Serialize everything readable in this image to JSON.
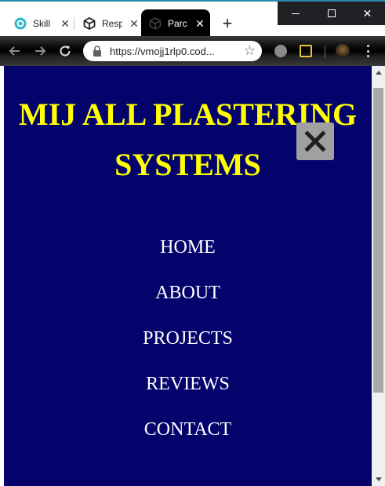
{
  "browser": {
    "tabs": [
      {
        "title": "Skill",
        "icon": "skillshare-icon",
        "active": false
      },
      {
        "title": "Resp",
        "icon": "codesandbox-icon",
        "active": false
      },
      {
        "title": "Parc",
        "icon": "codesandbox-icon",
        "active": true
      }
    ],
    "close_tab_glyph": "✕",
    "new_tab_glyph": "+",
    "window_close_glyph": "✕",
    "url": "https://vmojj1rlp0.cod..."
  },
  "site": {
    "title": "MIJ ALL PLASTERING SYSTEMS",
    "close_menu_glyph": "✕",
    "nav": [
      "HOME",
      "ABOUT",
      "PROJECTS",
      "REVIEWS",
      "CONTACT"
    ]
  },
  "colors": {
    "page_background": "#03036b",
    "title_color": "#ffff00",
    "nav_text": "#ffffff",
    "close_button_bg": "#a0a0a0"
  }
}
